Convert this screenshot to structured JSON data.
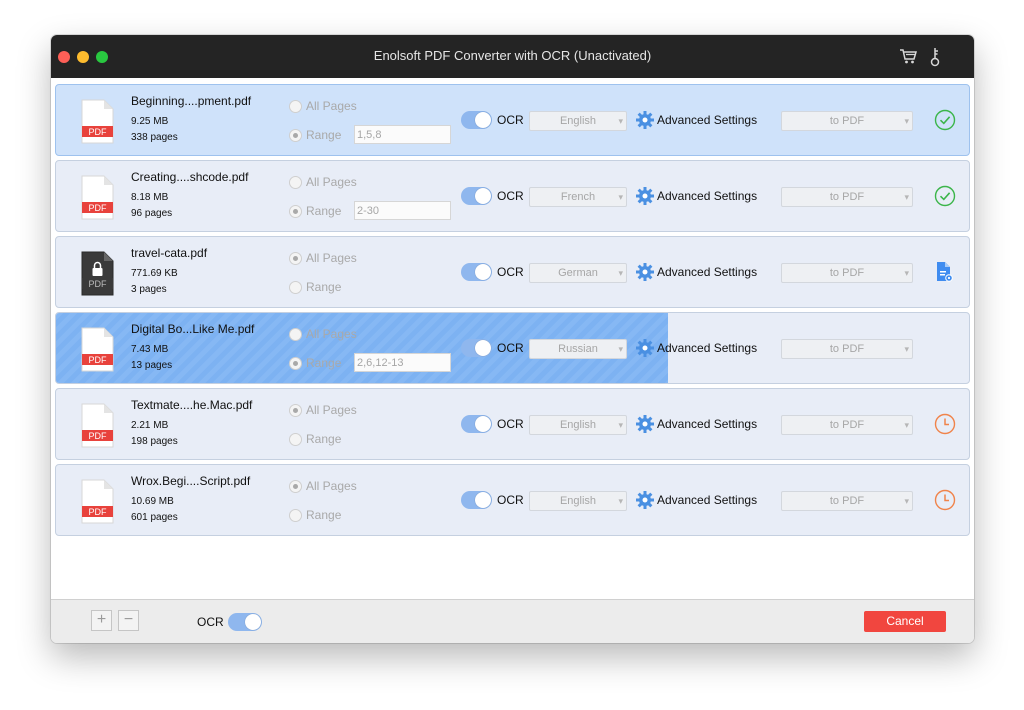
{
  "window": {
    "title": "Enolsoft PDF Converter with OCR (Unactivated)",
    "icons": [
      "cart-icon",
      "key-icon"
    ]
  },
  "labels": {
    "all_pages": "All Pages",
    "range": "Range",
    "ocr": "OCR",
    "advanced_settings": "Advanced Settings"
  },
  "files": [
    {
      "name": "Beginning....pment.pdf",
      "size": "9.25 MB",
      "pages": "338 pages",
      "icon_label": "PDF",
      "locked": false,
      "page_mode": "range",
      "range": "1,5,8",
      "language": "English",
      "format": "to PDF",
      "status": "done",
      "selected": true,
      "progress": 0
    },
    {
      "name": "Creating....shcode.pdf",
      "size": "8.18 MB",
      "pages": "96 pages",
      "icon_label": "PDF",
      "locked": false,
      "page_mode": "range",
      "range": "2-30",
      "language": "French",
      "format": "to PDF",
      "status": "done",
      "selected": false,
      "progress": 0
    },
    {
      "name": "travel-cata.pdf",
      "size": "771.69 KB",
      "pages": "3 pages",
      "icon_label": "PDF",
      "locked": true,
      "page_mode": "all",
      "range": "",
      "language": "German",
      "format": "to PDF",
      "status": "locked",
      "selected": false,
      "progress": 0
    },
    {
      "name": "Digital Bo...Like Me.pdf",
      "size": "7.43 MB",
      "pages": "13 pages",
      "icon_label": "PDF",
      "locked": false,
      "page_mode": "range",
      "range": "2,6,12-13",
      "language": "Russian",
      "format": "to PDF",
      "status": "converting",
      "selected": false,
      "progress": 0.67
    },
    {
      "name": "Textmate....he.Mac.pdf",
      "size": "2.21 MB",
      "pages": "198 pages",
      "icon_label": "PDF",
      "locked": false,
      "page_mode": "all",
      "range": "",
      "language": "English",
      "format": "to PDF",
      "status": "waiting",
      "selected": false,
      "progress": 0
    },
    {
      "name": "Wrox.Begi....Script.pdf",
      "size": "10.69 MB",
      "pages": "601 pages",
      "icon_label": "PDF",
      "locked": false,
      "page_mode": "all",
      "range": "",
      "language": "English",
      "format": "to PDF",
      "status": "waiting",
      "selected": false,
      "progress": 0
    }
  ],
  "bottombar": {
    "add_label": "+",
    "remove_label": "−",
    "ocr_label": "OCR",
    "cancel_label": "Cancel"
  },
  "colors": {
    "accent_green": "#3bb54a",
    "waiting_orange": "#f0834a",
    "info_blue": "#3f8cf0",
    "cancel_red": "#f1463f",
    "pdf_red": "#e8423c"
  }
}
